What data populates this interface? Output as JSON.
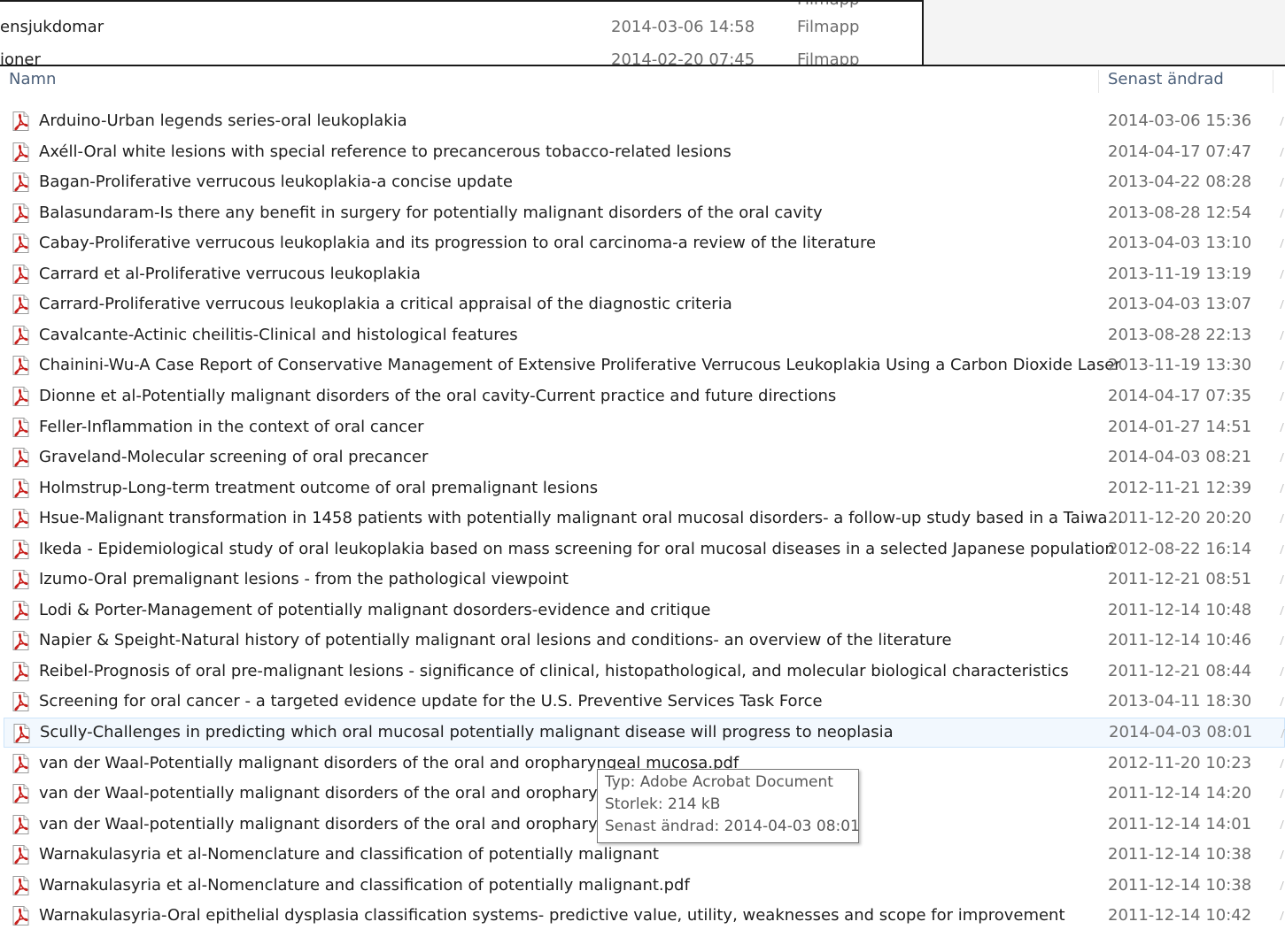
{
  "top_rows": [
    {
      "name": "",
      "date": "",
      "type": "Filmapp"
    },
    {
      "name": "ensjukdomar",
      "date": "2014-03-06 14:58",
      "type": "Filmapp"
    },
    {
      "name": "ioner",
      "date": "2014-02-20 07:45",
      "type": "Filmapp"
    }
  ],
  "columns": {
    "name": "Namn",
    "modified": "Senast ändrad"
  },
  "icons": {
    "file": "pdf-icon"
  },
  "colors": {
    "pdf_red": "#c8201d",
    "selection_bg": "#f2f8fe",
    "selection_border": "#cde4fa",
    "header_text": "#4c607a"
  },
  "files": [
    {
      "name": "Arduino-Urban legends series-oral leukoplakia",
      "date": "2014-03-06 15:36"
    },
    {
      "name": "Axéll-Oral white lesions with special reference to precancerous tobacco-related lesions",
      "date": "2014-04-17 07:47"
    },
    {
      "name": "Bagan-Proliferative verrucous leukoplakia-a concise update",
      "date": "2013-04-22 08:28"
    },
    {
      "name": "Balasundaram-Is there any benefit in surgery for potentially malignant disorders of the oral cavity",
      "date": "2013-08-28 12:54"
    },
    {
      "name": "Cabay-Proliferative verrucous leukoplakia and its progression to oral carcinoma-a review of the literature",
      "date": "2013-04-03 13:10"
    },
    {
      "name": "Carrard et al-Proliferative verrucous leukoplakia",
      "date": "2013-11-19 13:19"
    },
    {
      "name": "Carrard-Proliferative verrucous leukoplakia a critical appraisal of the diagnostic criteria",
      "date": "2013-04-03 13:07"
    },
    {
      "name": "Cavalcante-Actinic cheilitis-Clinical and histological features",
      "date": "2013-08-28 22:13"
    },
    {
      "name": "Chainini-Wu-A Case Report of Conservative Management of Extensive Proliferative Verrucous Leukoplakia Using a Carbon Dioxide Laser",
      "date": "2013-11-19 13:30"
    },
    {
      "name": "Dionne et al-Potentially malignant disorders of the oral cavity-Current practice and future directions",
      "date": "2014-04-17 07:35"
    },
    {
      "name": "Feller-Inflammation in the context of oral cancer",
      "date": "2014-01-27 14:51"
    },
    {
      "name": "Graveland-Molecular screening of oral precancer",
      "date": "2014-04-03 08:21"
    },
    {
      "name": "Holmstrup-Long-term treatment outcome of oral premalignant lesions",
      "date": "2012-11-21 12:39"
    },
    {
      "name": "Hsue-Malignant transformation in 1458 patients with potentially malignant oral mucosal disorders- a follow-up study based in a Taiwa...",
      "date": "2011-12-20 20:20"
    },
    {
      "name": "Ikeda - Epidemiological study of oral leukoplakia based on mass screening for oral mucosal diseases in a selected Japanese population",
      "date": "2012-08-22 16:14"
    },
    {
      "name": "Izumo-Oral premalignant lesions - from the pathological viewpoint",
      "date": "2011-12-21 08:51"
    },
    {
      "name": "Lodi & Porter-Management of potentially malignant dosorders-evidence and critique",
      "date": "2011-12-14 10:48"
    },
    {
      "name": "Napier & Speight-Natural history of potentially malignant oral lesions and conditions- an overview of the literature",
      "date": "2011-12-14 10:46"
    },
    {
      "name": "Reibel-Prognosis of oral pre-malignant lesions - significance of clinical, histopathological, and molecular biological characteristics",
      "date": "2011-12-21 08:44"
    },
    {
      "name": "Screening for oral cancer - a targeted evidence update for the U.S. Preventive Services Task Force",
      "date": "2013-04-11 18:30"
    },
    {
      "name": "Scully-Challenges in predicting which oral mucosal potentially malignant disease will progress to neoplasia",
      "date": "2014-04-03 08:01",
      "selected": true
    },
    {
      "name": "van der Waal-Potentially malignant disorders of the oral and oropharyngeal mucosa.pdf",
      "date": "2012-11-20 10:23"
    },
    {
      "name": "van der Waal-potentially malignant disorders of the oral and oropharyngeal mucosa",
      "date": "2011-12-14 14:20"
    },
    {
      "name": "van der Waal-potentially malignant disorders of the oral and oropharyngeal mucosa",
      "date": "2011-12-14 14:01"
    },
    {
      "name": "Warnakulasyria et al-Nomenclature and classification of potentially malignant",
      "date": "2011-12-14 10:38"
    },
    {
      "name": "Warnakulasyria et al-Nomenclature and classification of potentially malignant.pdf",
      "date": "2011-12-14 10:38"
    },
    {
      "name": "Warnakulasyria-Oral epithelial dysplasia classification systems- predictive value, utility, weaknesses and scope for improvement",
      "date": "2011-12-14 10:42"
    }
  ],
  "tooltip": {
    "type": "Typ: Adobe Acrobat Document",
    "size": "Storlek: 214 kB",
    "modified": "Senast ändrad: 2014-04-03 08:01"
  }
}
